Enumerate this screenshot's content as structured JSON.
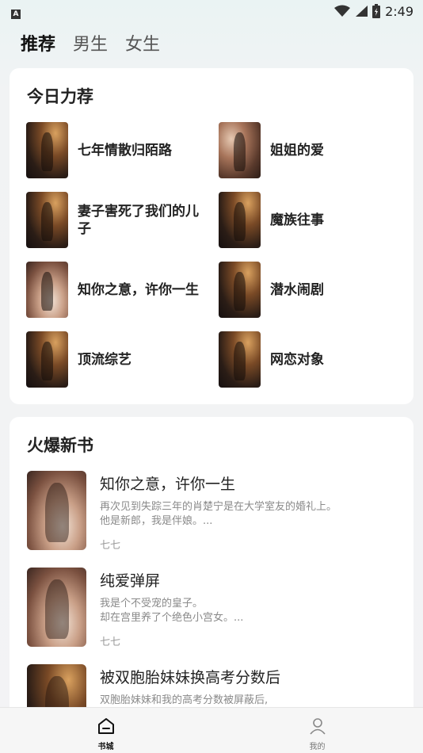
{
  "status_bar": {
    "app_badge": "A",
    "time": "2:49",
    "icons": [
      "wifi-icon",
      "signal-icon",
      "battery-icon"
    ]
  },
  "top_tabs": [
    {
      "label": "推荐",
      "active": true
    },
    {
      "label": "男生",
      "active": false
    },
    {
      "label": "女生",
      "active": false
    }
  ],
  "recommend": {
    "title": "今日力荐",
    "books": [
      {
        "title": "七年情散归陌路"
      },
      {
        "title": "姐姐的爱"
      },
      {
        "title": "妻子害死了我们的儿子"
      },
      {
        "title": "魔族往事"
      },
      {
        "title": "知你之意，许你一生"
      },
      {
        "title": "潜水闹剧"
      },
      {
        "title": "顶流综艺"
      },
      {
        "title": "网恋对象"
      }
    ]
  },
  "hot_new": {
    "title": "火爆新书",
    "books": [
      {
        "title": "知你之意，许你一生",
        "desc_line1": "再次见到失踪三年的肖楚宁是在大学室友的婚礼上。",
        "desc_line2": "他是新郎，我是伴娘。...",
        "author": "七七"
      },
      {
        "title": "纯爱弹屏",
        "desc_line1": "我是个不受宠的皇子。",
        "desc_line2": "却在宫里养了个绝色小宫女。...",
        "author": "七七"
      },
      {
        "title": "被双胞胎妹妹换高考分数后",
        "desc_line1": "双胞胎妹妹和我的高考分数被屏蔽后,",
        "desc_line2": "",
        "author": ""
      }
    ]
  },
  "bottom_nav": [
    {
      "label": "书城",
      "icon": "bookstore-icon",
      "active": true
    },
    {
      "label": "我的",
      "icon": "profile-icon",
      "active": false
    }
  ]
}
